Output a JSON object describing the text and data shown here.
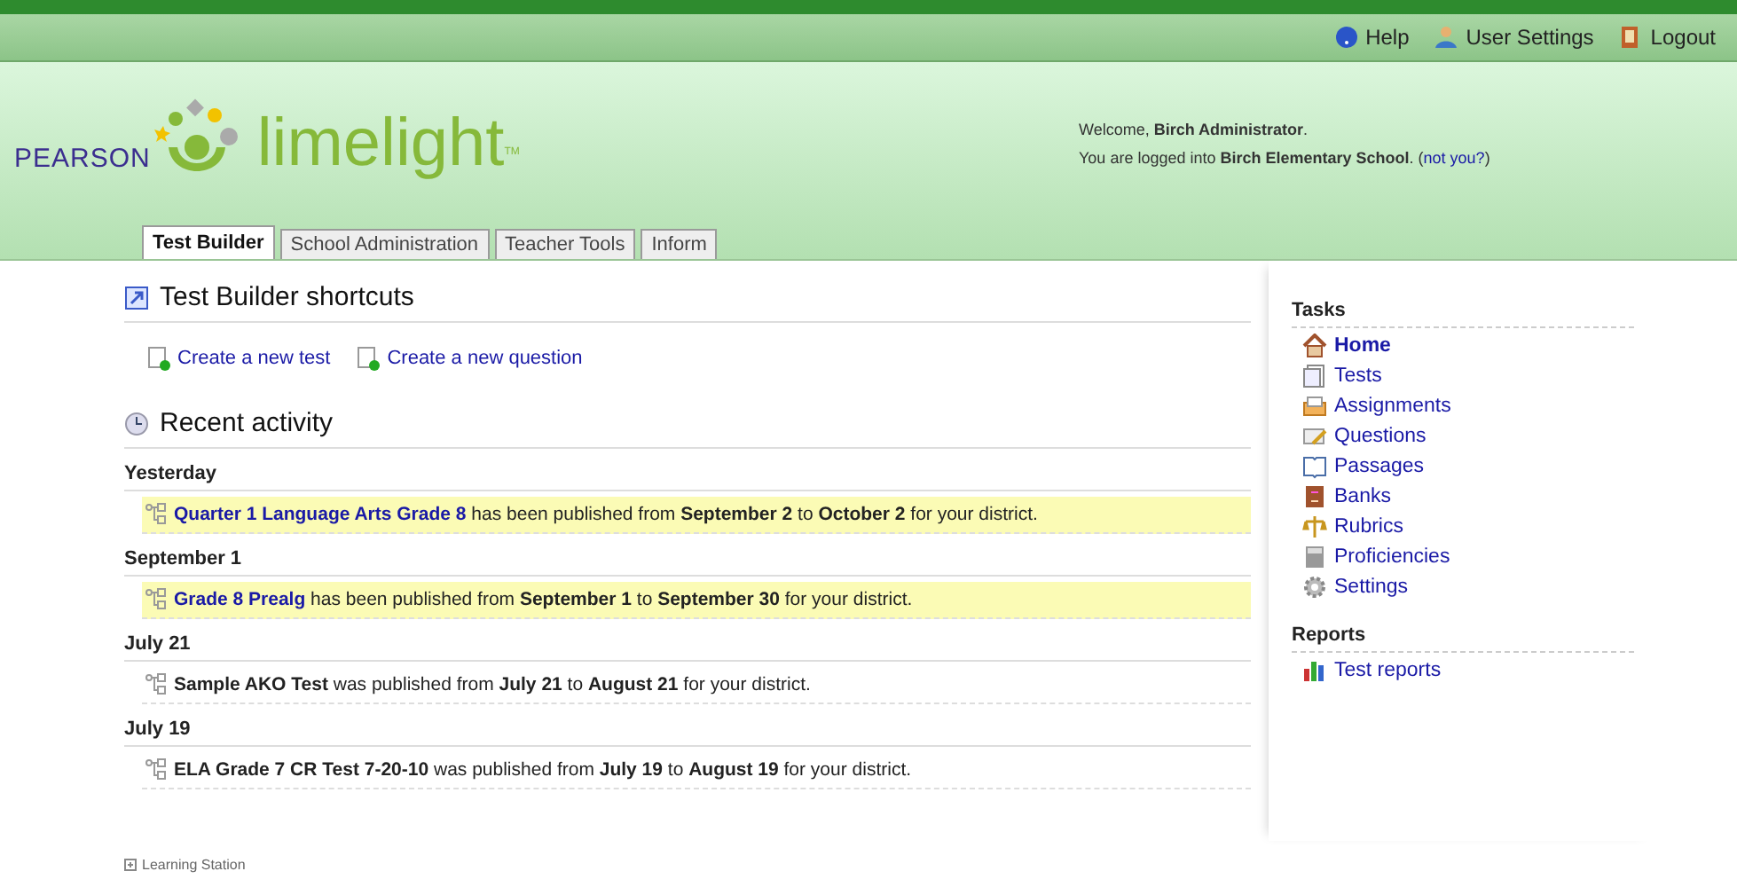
{
  "top_links": [
    {
      "label": "Help"
    },
    {
      "label": "User Settings"
    },
    {
      "label": "Logout"
    }
  ],
  "logo": {
    "brand": "PEARSON",
    "product": "limelight",
    "mark": "TM"
  },
  "welcome": {
    "greeting": "Welcome, **Birch Administrator**.",
    "login": "You are logged into **Birch Elementary School**. (",
    "not_you": "not you?",
    "close": ")"
  },
  "tabs": [
    {
      "label": "Test Builder",
      "selected": true
    },
    {
      "label": "School Administration",
      "selected": false
    },
    {
      "label": "Teacher Tools",
      "selected": false
    },
    {
      "label": "Inform",
      "selected": false
    }
  ],
  "shortcuts": {
    "title": "Test Builder shortcuts",
    "links": [
      "Create a new test",
      "Create a new question"
    ]
  },
  "recent": {
    "title": "Recent activity",
    "groups": [
      {
        "date": "Yesterday",
        "items": [
          {
            "title": "Quarter 1 Language Arts Grade 8",
            "linked": true,
            "highlighted": true,
            "text": "has been published from **September 2** to **October 2** for your district."
          }
        ]
      },
      {
        "date": "September 1",
        "items": [
          {
            "title": "Grade 8 Prealg",
            "linked": true,
            "highlighted": true,
            "text": "has been published from **September 1** to **September 30** for your district."
          }
        ]
      },
      {
        "date": "July 21",
        "items": [
          {
            "title": "Sample AKO Test",
            "linked": false,
            "highlighted": false,
            "text": "was published from **July 21** to **August 21** for your district."
          }
        ]
      },
      {
        "date": "July 19",
        "items": [
          {
            "title": "ELA Grade 7 CR Test 7-20-10",
            "linked": false,
            "highlighted": false,
            "text": "was published from **July 19** to **August 19** for your district."
          }
        ]
      }
    ]
  },
  "tasks": {
    "title": "Tasks",
    "items": [
      {
        "label": "Home",
        "selected": true
      },
      {
        "label": "Tests",
        "selected": false
      },
      {
        "label": "Assignments",
        "selected": false
      },
      {
        "label": "Questions",
        "selected": false
      },
      {
        "label": "Passages",
        "selected": false
      },
      {
        "label": "Banks",
        "selected": false
      },
      {
        "label": "Rubrics",
        "selected": false
      },
      {
        "label": "Proficiencies",
        "selected": false
      },
      {
        "label": "Settings",
        "selected": false
      }
    ]
  },
  "reports": {
    "title": "Reports",
    "items": [
      {
        "label": "Test reports",
        "selected": false
      }
    ]
  },
  "footer": {
    "label": "Learning Station"
  }
}
